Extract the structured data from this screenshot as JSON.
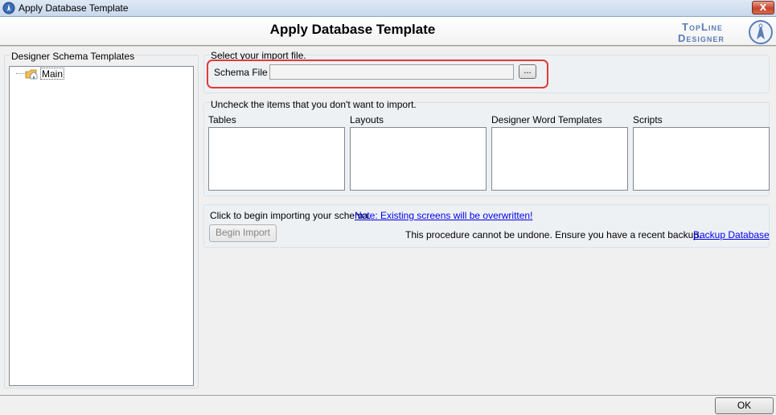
{
  "window": {
    "title": "Apply Database Template",
    "close_label": "X"
  },
  "header": {
    "title": "Apply Database Template",
    "logo_line1": "TopLine",
    "logo_line2": "Designer"
  },
  "left_panel": {
    "label": "Designer Schema Templates",
    "tree": [
      {
        "label": "Main"
      }
    ]
  },
  "import_file": {
    "label": "Select your import file.",
    "field_label": "Schema File",
    "value": "",
    "browse_label": "..."
  },
  "import_items": {
    "label": "Uncheck the items that you don't want to import.",
    "columns": [
      "Tables",
      "Layouts",
      "Designer Word Templates",
      "Scripts"
    ]
  },
  "begin": {
    "prompt": "Click to begin importing your schema.",
    "warning_link": "Note:  Existing screens will be overwritten!",
    "button_label": "Begin Import",
    "notice": "This procedure cannot be undone.   Ensure you have a recent backup.",
    "backup_link": "Backup Database"
  },
  "footer": {
    "ok_label": "OK"
  },
  "colors": {
    "highlight": "#e23a3a",
    "link": "#0000ee",
    "logo": "#5b7db5"
  },
  "icons": [
    "app-icon",
    "close-icon",
    "logo-mark",
    "folder-home-icon"
  ]
}
